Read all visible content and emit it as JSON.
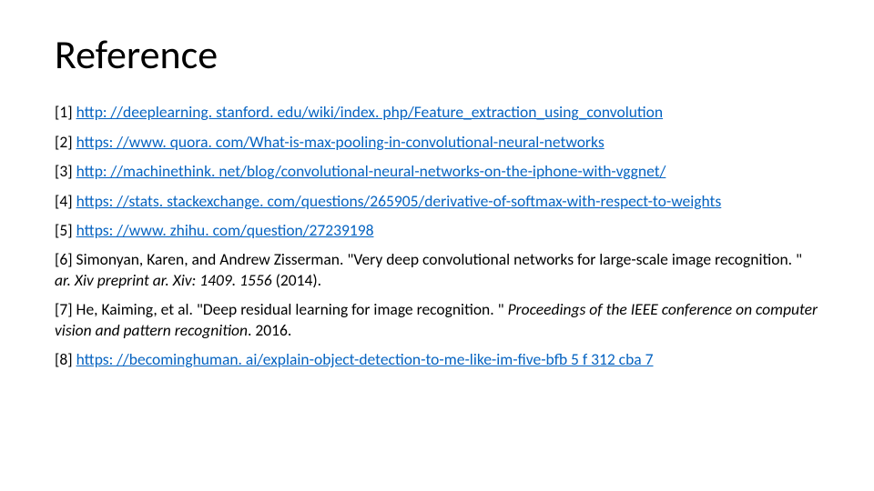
{
  "title": "Reference",
  "refs": {
    "r1_num": "[1] ",
    "r1_link": "http: //deeplearning. stanford. edu/wiki/index. php/Feature_extraction_using_convolution",
    "r2_num": "[2] ",
    "r2_link": "https: //www. quora. com/What-is-max-pooling-in-convolutional-neural-networks",
    "r3_num": "[3] ",
    "r3_link": "http: //machinethink. net/blog/convolutional-neural-networks-on-the-iphone-with-vggnet/",
    "r4_num": "[4] ",
    "r4_link": "https: //stats. stackexchange. com/questions/265905/derivative-of-softmax-with-respect-to-weights",
    "r5_num": "[5] ",
    "r5_link": "https: //www. zhihu. com/question/27239198",
    "r6_a": "[6] Simonyan, Karen, and Andrew Zisserman. \"Very deep convolutional networks for large-scale image recognition. \" ",
    "r6_i": "ar. Xiv preprint ar. Xiv: 1409. 1556",
    "r6_b": " (2014).",
    "r7_a": "[7] He, Kaiming, et al. \"Deep residual learning for image recognition. \" ",
    "r7_i": "Proceedings of the IEEE conference on computer vision and pattern recognition",
    "r7_b": ". 2016.",
    "r8_num": "[8] ",
    "r8_link": "https: //becominghuman. ai/explain-object-detection-to-me-like-im-five-bfb 5 f 312 cba 7"
  }
}
